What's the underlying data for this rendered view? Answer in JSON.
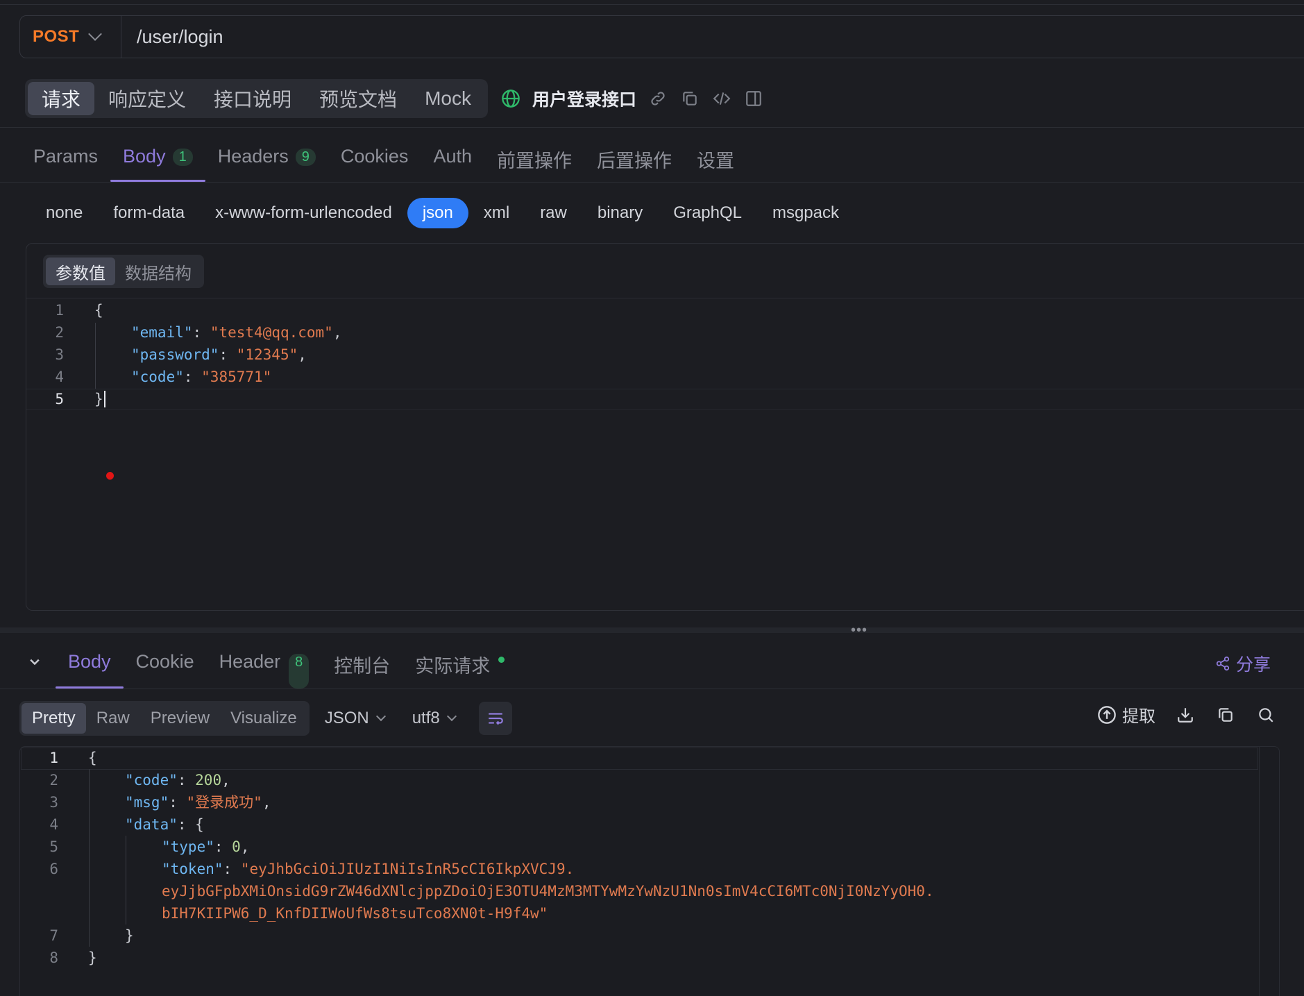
{
  "request": {
    "method": "POST",
    "url": "/user/login"
  },
  "mode_tabs": [
    "请求",
    "响应定义",
    "接口说明",
    "预览文档",
    "Mock"
  ],
  "api_name": "用户登录接口",
  "request_tabs": [
    {
      "label": "Params",
      "badge": ""
    },
    {
      "label": "Body",
      "badge": "1"
    },
    {
      "label": "Headers",
      "badge": "9"
    },
    {
      "label": "Cookies",
      "badge": ""
    },
    {
      "label": "Auth",
      "badge": ""
    },
    {
      "label": "前置操作",
      "badge": ""
    },
    {
      "label": "后置操作",
      "badge": ""
    },
    {
      "label": "设置",
      "badge": ""
    }
  ],
  "body_types": [
    "none",
    "form-data",
    "x-www-form-urlencoded",
    "json",
    "xml",
    "raw",
    "binary",
    "GraphQL",
    "msgpack"
  ],
  "body_editor": {
    "segments": [
      "参数值",
      "数据结构"
    ],
    "lines": [
      "1",
      "2",
      "3",
      "4",
      "5"
    ],
    "code": {
      "open": "{",
      "email_key": "\"email\"",
      "email_val": "\"test4@qq.com\"",
      "password_key": "\"password\"",
      "password_val": "\"12345\"",
      "code_key": "\"code\"",
      "code_val": "\"385771\"",
      "close": "}"
    }
  },
  "response_tabs": [
    {
      "label": "Body",
      "badge": ""
    },
    {
      "label": "Cookie",
      "badge": ""
    },
    {
      "label": "Header",
      "badge": "8"
    },
    {
      "label": "控制台",
      "badge": ""
    },
    {
      "label": "实际请求",
      "badge": ""
    }
  ],
  "share_label": "分享",
  "response_toolbar": {
    "views": [
      "Pretty",
      "Raw",
      "Preview",
      "Visualize"
    ],
    "format": "JSON",
    "encoding": "utf8",
    "extract_label": "提取"
  },
  "response_body": {
    "lines": [
      "1",
      "2",
      "3",
      "4",
      "5",
      "6",
      "7",
      "8"
    ],
    "code_key": "\"code\"",
    "code_val": "200",
    "msg_key": "\"msg\"",
    "msg_val": "\"登录成功\"",
    "data_key": "\"data\"",
    "type_key": "\"type\"",
    "type_val": "0",
    "token_key": "\"token\"",
    "token_line1": "\"eyJhbGciOiJIUzI1NiIsInR5cCI6IkpXVCJ9.",
    "token_line2": "eyJjbGFpbXMiOnsidG9rZW46dXNlcjppZDoiOjE3OTU4MzM3MTYwMzYwNzU1Nn0sImV4cCI6MTc0NjI0NzYyOH0.",
    "token_line3": "bIH7KIIPW6_D_KnfDIIWoUfWs8tsuTco8XN0t-H9f4w\""
  },
  "colors": {
    "accent": "#8f7bdc",
    "method": "#f57a28",
    "json_active": "#2f7cf6",
    "success": "#3ec27a"
  }
}
